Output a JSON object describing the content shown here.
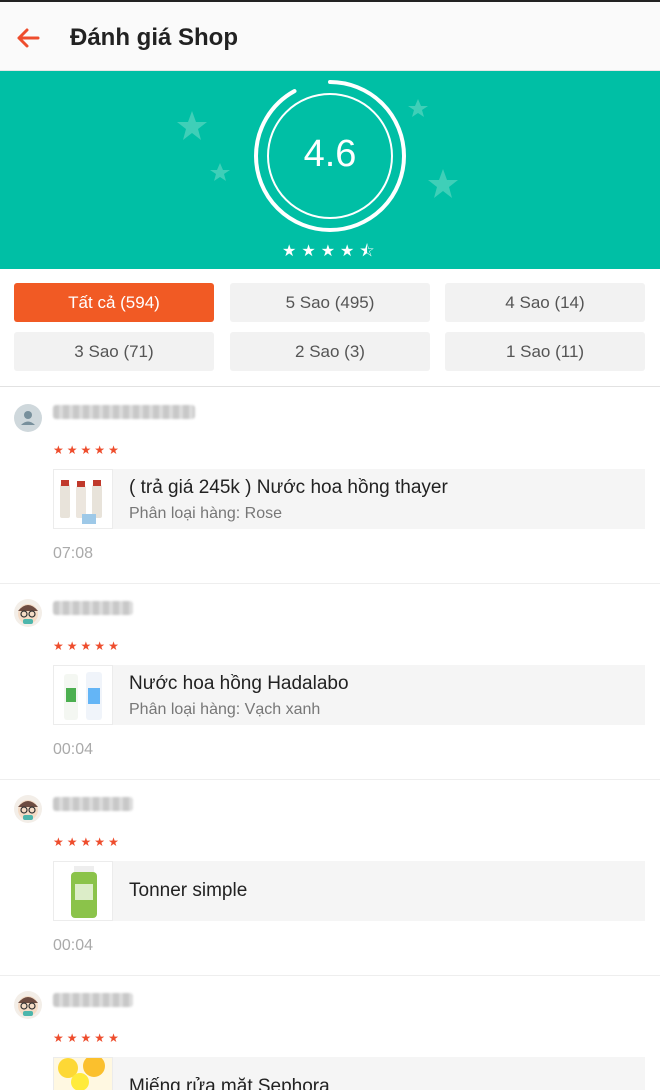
{
  "header": {
    "title": "Đánh giá Shop",
    "back_icon": "arrow-left-icon"
  },
  "summary": {
    "score": "4.6",
    "rating": 4.6,
    "max_rating": 5,
    "brand_color": "#00bfa5"
  },
  "filters": [
    {
      "label": "Tất cả (594)",
      "active": true
    },
    {
      "label": "5 Sao (495)",
      "active": false
    },
    {
      "label": "4 Sao (14)",
      "active": false
    },
    {
      "label": "3 Sao (71)",
      "active": false
    },
    {
      "label": "2 Sao (3)",
      "active": false
    },
    {
      "label": "1 Sao (11)",
      "active": false
    }
  ],
  "accent_color": "#f15a24",
  "reviews": [
    {
      "stars": 5,
      "product": "( trả giá 245k ) Nước hoa hồng thayer",
      "variant": "Phân loại hàng: Rose",
      "time": "07:08"
    },
    {
      "stars": 5,
      "product": "Nước hoa hồng Hadalabo",
      "variant": "Phân loại hàng: Vạch xanh",
      "time": "00:04"
    },
    {
      "stars": 5,
      "product": "Tonner simple",
      "variant": "",
      "time": "00:04"
    },
    {
      "stars": 5,
      "product": "Miếng rửa mặt Sephora",
      "variant": "",
      "time": ""
    }
  ]
}
